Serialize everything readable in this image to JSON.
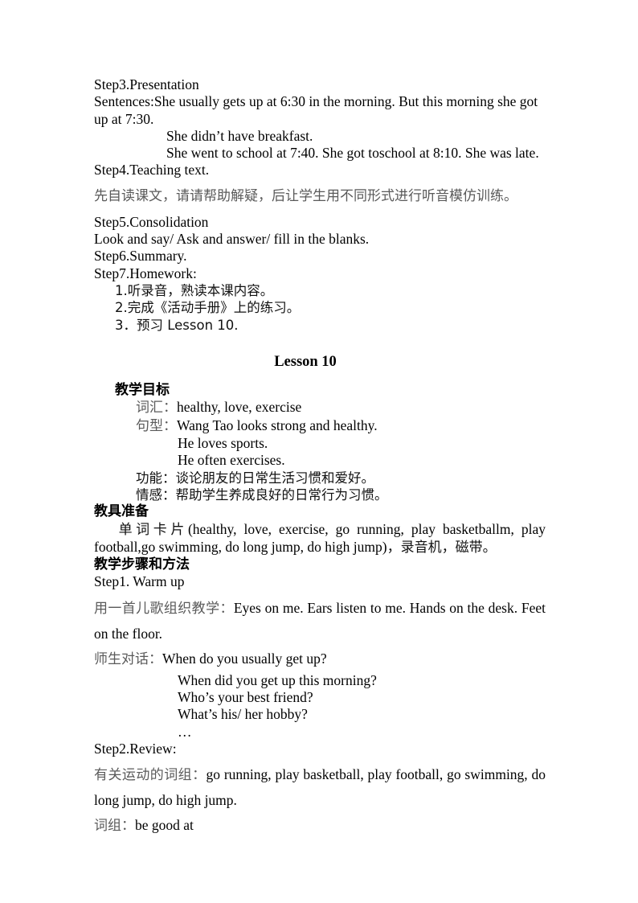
{
  "document": {
    "page_background": "#ffffff",
    "text_color": "#000000",
    "annotation_color": "#5a5a5a"
  },
  "previous_lesson": {
    "step3_heading": "Step3.Presentation",
    "sentences_line": "Sentences:She usually gets up at 6:30 in the morning. But this morning she got up at 7:30.",
    "sentence_2": "She didn’t have breakfast.",
    "sentence_3": "She went to school at 7:40. She got toschool at 8:10. She was late.",
    "step4_heading": "Step4.Teaching text.",
    "step4_note_cn": "先自读课文，请请帮助解疑，后让学生用不同形式进行听音模仿训练。",
    "step5_heading": "Step5.Consolidation",
    "step5_body": "Look and say/ Ask and answer/ fill in the blanks.",
    "step6_heading": "Step6.Summary.",
    "step7_heading": "Step7.Homework:",
    "homework": [
      "1.听录音，熟读本课内容。",
      "2.完成《活动手册》上的练习。",
      "3．预习 Lesson 10."
    ]
  },
  "lesson": {
    "title": "Lesson 10",
    "objectives": {
      "heading_cn": "教学目标",
      "vocab_label": "词汇：",
      "vocab_value": "healthy, love, exercise",
      "pattern_label": "句型：",
      "pattern_lines": [
        "Wang Tao looks strong and healthy.",
        "He loves sports.",
        "He often exercises."
      ],
      "function_line": "功能：谈论朋友的日常生活习惯和爱好。",
      "emotion_line": "情感：帮助学生养成良好的日常行为习惯。"
    },
    "materials": {
      "heading_cn": "教具准备",
      "body_cn_prefix": "单词卡片",
      "body_en": "(healthy, love, exercise, go running, play basketballm, play football,go swimming, do long jump, do high jump)",
      "body_cn_suffix": "，录音机，磁带。"
    },
    "procedure": {
      "heading_cn": "教学步骤和方法",
      "step1_heading": "Step1. Warm up",
      "step1_cn_label": "用一首儿歌组织教学：",
      "step1_en": "Eyes on me. Ears listen to me. Hands on the desk. Feet on the floor.",
      "dialogue_label_cn": "师生对话：",
      "dialogue_first": "When do you usually get up?",
      "dialogue_rest": [
        "When did you get up this morning?",
        "Who’s your best friend?",
        "What’s his/ her hobby?",
        "…"
      ],
      "step2_heading": "Step2.Review:",
      "review_cn_label": "有关运动的词组：",
      "review_en": "go running, play basketball, play football, go swimming, do long jump, do high jump.",
      "phrase_cn_label": "词组：",
      "phrase_en": "be good at"
    }
  }
}
